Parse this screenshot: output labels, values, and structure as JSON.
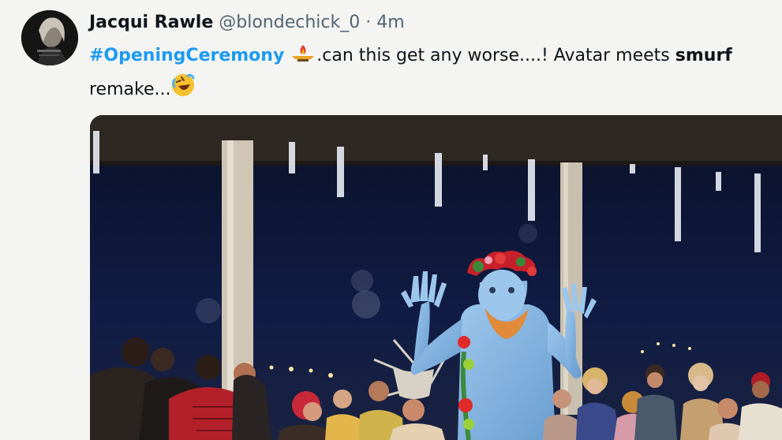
{
  "tweet": {
    "author_name": "Jacqui Rawle",
    "handle": "@blondechick_0",
    "separator": "·",
    "timestamp": "4m",
    "hashtag": "#OpeningCeremony",
    "text_part1": ".can this get any worse....! Avatar meets ",
    "text_bold": "smurf",
    "text_part2": "remake...",
    "emoji_1": "olympic-torch-emoji",
    "emoji_2": "rolling-on-floor-laughing-emoji"
  },
  "colors": {
    "hashtag": "#1d9bf0",
    "background": "#f4f4f3",
    "secondary_text": "#536471"
  }
}
